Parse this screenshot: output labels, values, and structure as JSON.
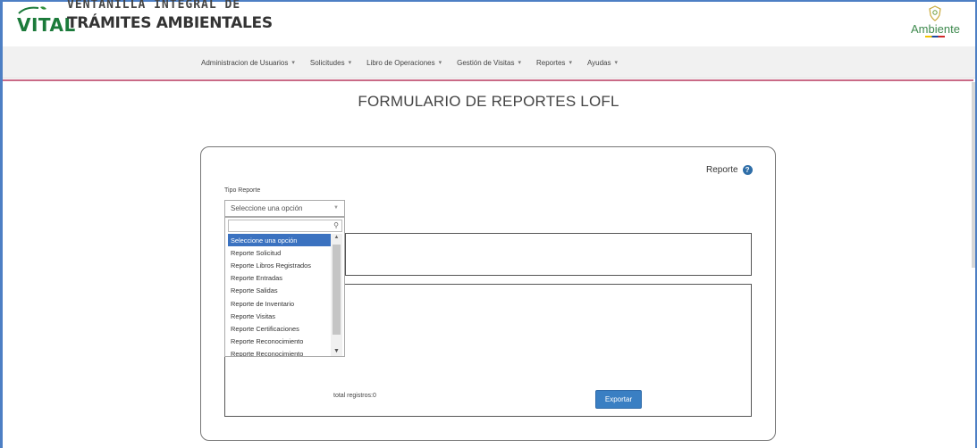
{
  "header": {
    "logo_word": "VITAL",
    "logo_line1": "VENTANILLA INTEGRAL DE",
    "logo_line2": "TRÁMITES AMBIENTALES",
    "brand_text": "Ambiente"
  },
  "nav": {
    "items": [
      {
        "label": "Administracion de Usuarios"
      },
      {
        "label": "Solicitudes"
      },
      {
        "label": "Libro de Operaciones"
      },
      {
        "label": "Gestión de Visitas"
      },
      {
        "label": "Reportes"
      },
      {
        "label": "Ayudas"
      }
    ],
    "caret": "▾"
  },
  "page": {
    "title": "FORMULARIO DE REPORTES LOFL"
  },
  "form": {
    "help_label": "Reporte",
    "help_icon": "?",
    "tipo_label": "Tipo Reporte",
    "select_value": "Seleccione una opción",
    "search_value": "",
    "options": [
      "Seleccione una opción",
      "Reporte Solicitud",
      "Reporte Libros Registrados",
      "Reporte Entradas",
      "Reporte Salidas",
      "Reporte de Inventario",
      "Reporte Visitas",
      "Reporte Certificaciones",
      "Reporte Reconocimiento",
      "Reporte Reconocimiento"
    ],
    "selected_index": 0,
    "total_label": "total registros:0",
    "export_label": "Exportar"
  },
  "colors": {
    "accent": "#3b72c0",
    "nav_accent": "#c96a86",
    "brand_green": "#1b7a3a"
  }
}
